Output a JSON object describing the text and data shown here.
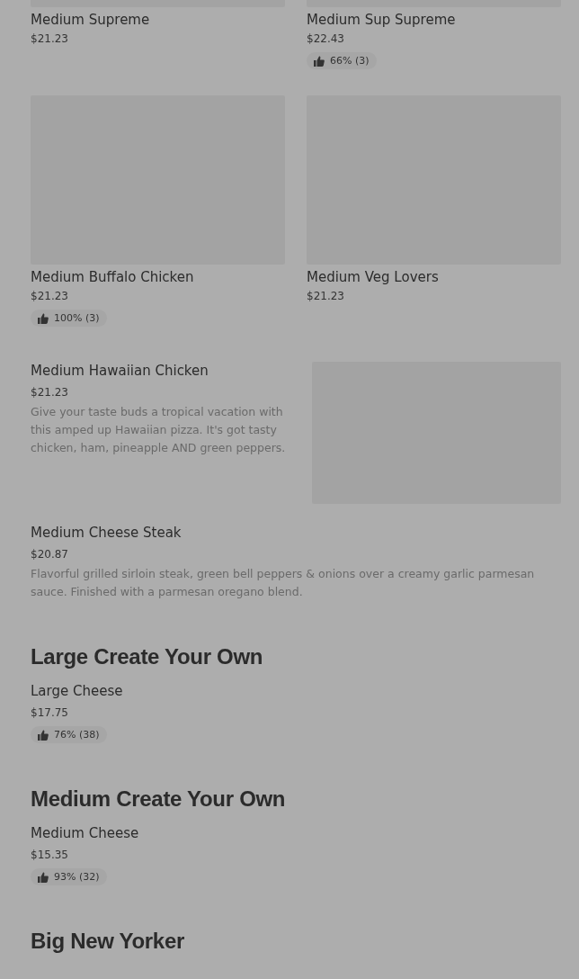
{
  "sections": [
    {
      "items": [
        {
          "kind": "grid",
          "thumbnail": true,
          "name": "Medium Supreme",
          "price": "$21.23"
        },
        {
          "kind": "grid",
          "thumbnail": true,
          "name": "Medium Sup Supreme",
          "price": "$22.43",
          "rating": "66% (3)"
        },
        {
          "kind": "grid",
          "thumbnail": true,
          "name": "Medium Buffalo Chicken",
          "price": "$21.23",
          "rating": "100% (3)"
        },
        {
          "kind": "grid",
          "thumbnail": true,
          "name": "Medium Veg Lovers",
          "price": "$21.23"
        },
        {
          "kind": "row",
          "thumbnail": true,
          "name": "Medium Hawaiian Chicken",
          "price": "$21.23",
          "description": "Give your taste buds a tropical vacation with this amped up Hawaiian pizza. It's got tasty chicken, ham, pineapple AND green peppers."
        },
        {
          "kind": "row",
          "thumbnail": false,
          "name": "Medium Cheese Steak",
          "price": "$20.87",
          "description": "Flavorful grilled sirloin steak, green bell peppers & onions over a creamy garlic parmesan sauce. Finished with a parmesan oregano blend."
        }
      ]
    },
    {
      "heading": "Large Create Your Own",
      "items": [
        {
          "kind": "row",
          "thumbnail": false,
          "name": "Large Cheese",
          "price": "$17.75",
          "rating": "76% (38)"
        }
      ]
    },
    {
      "heading": "Medium Create Your Own",
      "items": [
        {
          "kind": "row",
          "thumbnail": false,
          "name": "Medium Cheese",
          "price": "$15.35",
          "rating": "93% (32)"
        }
      ]
    },
    {
      "heading": "Big New Yorker"
    }
  ]
}
